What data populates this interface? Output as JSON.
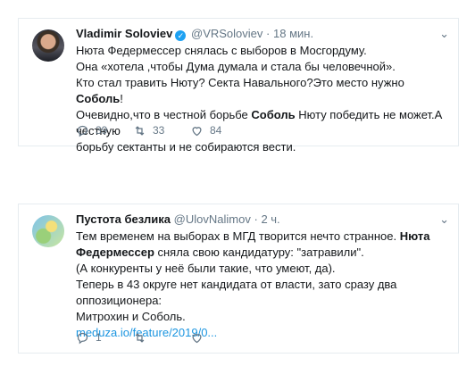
{
  "tweet1": {
    "name": "Vladimir Soloviev",
    "handle": "@VRSoloviev",
    "separator": "·",
    "time": "18 мин.",
    "lines": [
      "Нюта Федермессер снялась с выборов в Мосгордуму.",
      "Она «хотела ,чтобы Дума думала и стала бы человечной».",
      "Кто стал травить Нюту? Секта Навального?Это место нужно ",
      "Соболь",
      "!",
      "Очевидно,что в честной борьбе ",
      "Соболь",
      " Нюту победить не может.А честную",
      "борьбу сектанты и не собираются вести."
    ],
    "replies": "39",
    "retweets": "33",
    "likes": "84"
  },
  "tweet2": {
    "name": "Пустота безлика",
    "handle": "@UlovNalimov",
    "separator": "·",
    "time": "2 ч.",
    "lines": [
      "Тем временем на выборах в МГД творится нечто странное. ",
      "Нюта",
      "Федермессер",
      " сняла свою кандидатуру: \"затравили\".",
      "(А конкуренты у неё были такие, что умеют, да).",
      "Теперь в 43 округе нет кандидата от власти, зато сразу два оппозиционера:",
      "Митрохин и Соболь."
    ],
    "link": "meduza.io/feature/2019/0...",
    "replies": "1",
    "retweets": "",
    "likes": ""
  },
  "icons": {
    "reply": "reply-icon",
    "retweet": "retweet-icon",
    "like": "heart-icon",
    "verified": "verified-icon",
    "caret": "chevron-down-icon"
  },
  "colors": {
    "accent": "#1da1f2",
    "link": "#1b95e0",
    "muted": "#657786"
  }
}
